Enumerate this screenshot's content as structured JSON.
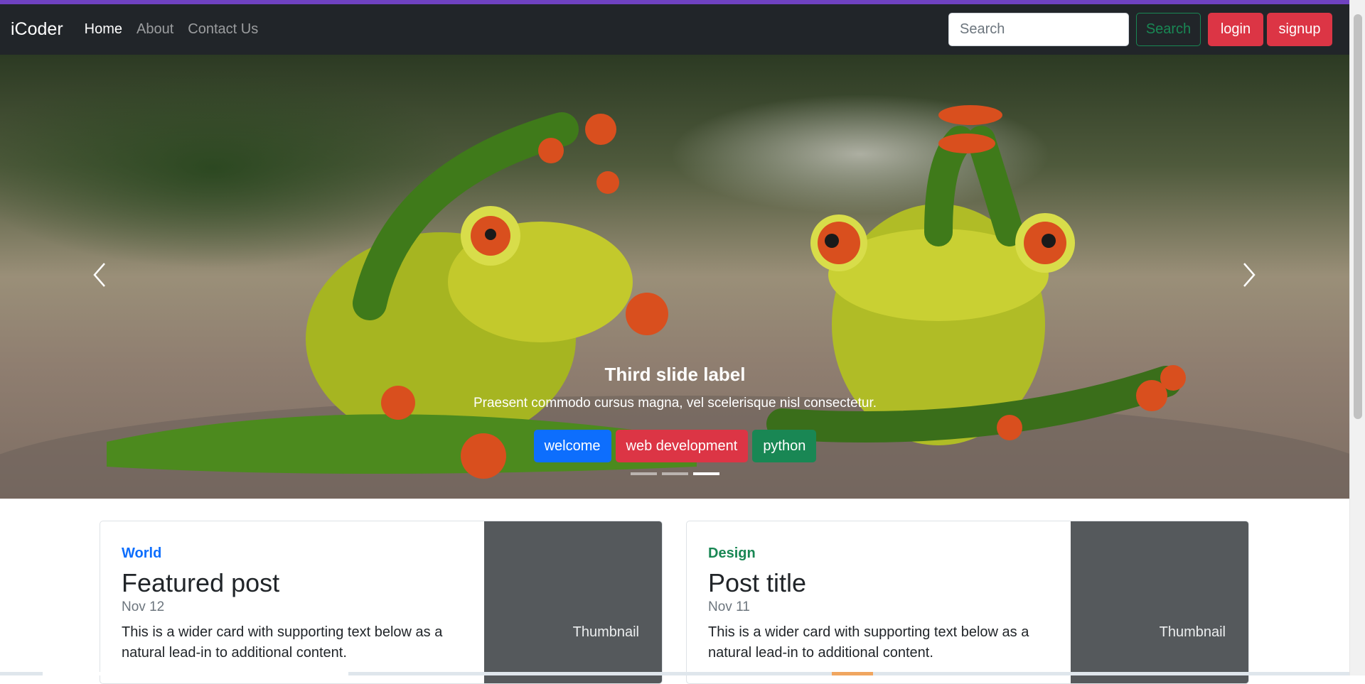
{
  "navbar": {
    "brand": "iCoder",
    "links": [
      {
        "label": "Home",
        "active": true
      },
      {
        "label": "About",
        "active": false
      },
      {
        "label": "Contact Us",
        "active": false
      }
    ],
    "search": {
      "placeholder": "Search",
      "value": ""
    },
    "search_button": "Search",
    "login_button": "login",
    "signup_button": "signup"
  },
  "carousel": {
    "caption_title": "Third slide label",
    "caption_text": "Praesent commodo cursus magna, vel scelerisque nisl consectetur.",
    "tags": [
      {
        "label": "welcome",
        "color": "#0d6efd"
      },
      {
        "label": "web development",
        "color": "#dc3545"
      },
      {
        "label": "python",
        "color": "#198754"
      }
    ],
    "indicator_count": 3,
    "active_indicator": 3,
    "prev_icon": "chevron-left-icon",
    "next_icon": "chevron-right-icon"
  },
  "cards": [
    {
      "category": "World",
      "category_color": "#0d6efd",
      "title": "Featured post",
      "date": "Nov 12",
      "text": "This is a wider card with supporting text below as a natural lead-in to additional content.",
      "thumbnail": "Thumbnail"
    },
    {
      "category": "Design",
      "category_color": "#198754",
      "title": "Post title",
      "date": "Nov 11",
      "text": "This is a wider card with supporting text below as a natural lead-in to additional content.",
      "thumbnail": "Thumbnail"
    }
  ],
  "colors": {
    "accent_bar": "#6f42c1",
    "navbar_bg": "#212529",
    "danger": "#dc3545",
    "success": "#198754",
    "primary": "#0d6efd"
  }
}
